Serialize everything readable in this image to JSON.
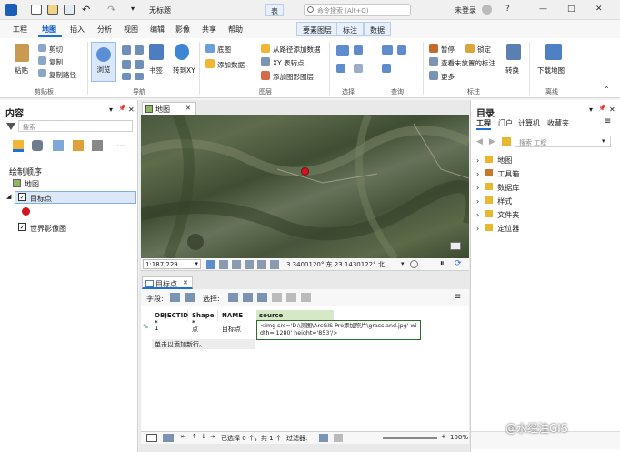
{
  "titlebar": {
    "title": "无标题",
    "search_placeholder": "命令搜索 (Alt+Q)",
    "login": "未登录",
    "help": "?",
    "minimize": "—",
    "maximize": "□",
    "close": "✕"
  },
  "tabs": {
    "project": "工程",
    "map": "地图",
    "insert": "插入",
    "analysis": "分析",
    "view": "视图",
    "edit": "编辑",
    "imagery": "影像",
    "share": "共享",
    "help": "帮助",
    "table": "表",
    "feature_layer": "要素图层",
    "labeling": "标注",
    "data": "数据"
  },
  "ribbon": {
    "paste": "粘贴",
    "cut": "剪切",
    "copy": "复制",
    "copy_path": "复制路径",
    "clipboard_group": "剪贴板",
    "explore": "浏览",
    "bookmarks": "书签",
    "goto_xy": "转到XY",
    "navigate_group": "导航",
    "basemap": "底图",
    "add_data": "添加数据",
    "add_data_from_path": "从路径添加数据",
    "xy_table_to_point": "XY 表转点",
    "add_graphics_layer": "添加图形图层",
    "layer_group": "图层",
    "selection_group": "选择",
    "query_group": "查询",
    "pause": "暂停",
    "lock": "锁定",
    "view_unplaced": "查看未放置的标注",
    "more": "更多",
    "convert": "转换",
    "labeling_group": "标注",
    "download_map": "下载地图",
    "offline_group": "离线"
  },
  "contents": {
    "title": "内容",
    "search_placeholder": "搜索",
    "drawing_order": "绘制顺序",
    "map_item": "地图",
    "target_layer": "目标点",
    "world_imagery": "世界影像图",
    "pin": "📌",
    "close": "✕"
  },
  "catalog": {
    "title": "目录",
    "tabs": [
      "工程",
      "门户",
      "计算机",
      "收藏夹"
    ],
    "search_placeholder": "搜索 工程",
    "items": [
      {
        "label": "地图",
        "color": "#f0b429"
      },
      {
        "label": "工具箱",
        "color": "#c7782a"
      },
      {
        "label": "数据库",
        "color": "#e8b830"
      },
      {
        "label": "样式",
        "color": "#e8b830"
      },
      {
        "label": "文件夹",
        "color": "#e8b830"
      },
      {
        "label": "定位器",
        "color": "#e8b830"
      }
    ]
  },
  "map_view": {
    "tab_label": "地图",
    "scale": "1:187,229",
    "coords": "3.3400120° 东  23.1430122° 北",
    "point_color": "#d4161c"
  },
  "attribute_table": {
    "tab_label": "目标点",
    "field_label": "字段:",
    "select_label": "选择:",
    "columns": [
      "OBJECTID *",
      "Shape *",
      "NAME",
      "source"
    ],
    "row": {
      "id": "1",
      "shape": "点",
      "name": "目标点"
    },
    "cell_edit": "<img src='D:\\测图\\ArcGIS Pro添加照片\\grassland.jpg' width='1280' height='853'/>",
    "new_row_hint": "单击以添加新行。",
    "status": "已选择 0 个，共 1 个",
    "filter_label": "过滤器:",
    "zoom": "100%"
  },
  "watermark": "@水经注GIS"
}
